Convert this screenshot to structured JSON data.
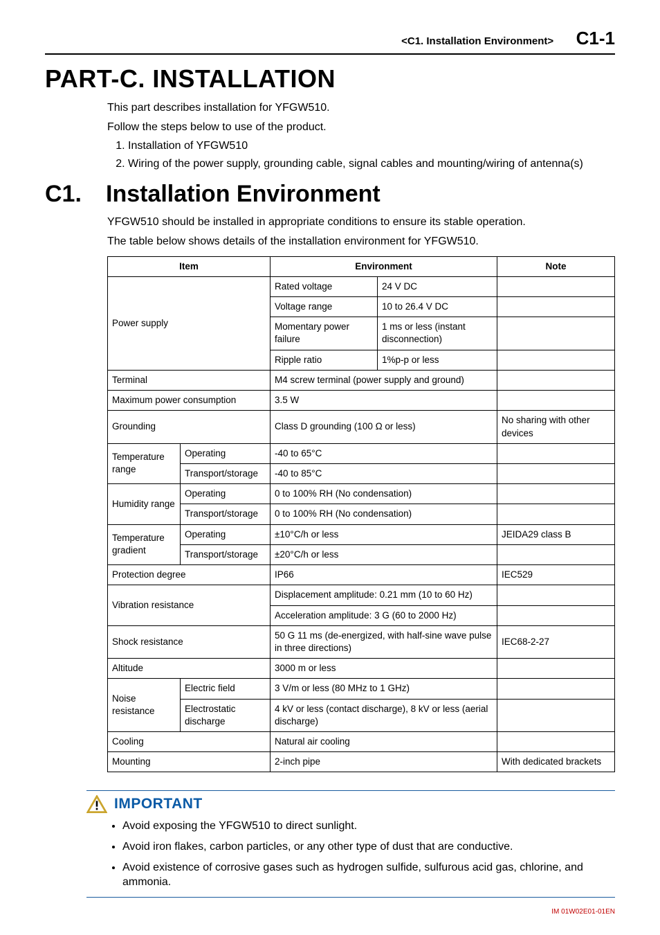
{
  "header": {
    "chapter_ref": "<C1.  Installation Environment>",
    "page_num": "C1-1"
  },
  "part": {
    "title": "PART-C.  INSTALLATION",
    "intro1": "This part describes installation for YFGW510.",
    "intro2": "Follow the steps below to use of the product.",
    "steps": [
      "Installation of YFGW510",
      "Wiring of the power supply, grounding cable, signal cables and mounting/wiring of antenna(s)"
    ]
  },
  "section": {
    "num": "C1.",
    "title": "Installation Environment",
    "p1": "YFGW510 should be installed in appropriate conditions to ensure its stable operation.",
    "p2": "The table below shows details of the installation environment for YFGW510."
  },
  "table": {
    "head": {
      "item": "Item",
      "env": "Environment",
      "note": "Note"
    },
    "rows": {
      "power_label": "Power supply",
      "power_rated_k": "Rated voltage",
      "power_rated_v": "24 V DC",
      "power_range_k": "Voltage range",
      "power_range_v": "10 to 26.4 V DC",
      "power_mom_k": "Momentary power failure",
      "power_mom_v": "1 ms or less (instant disconnection)",
      "power_ripple_k": "Ripple ratio",
      "power_ripple_v": "1%p-p or less",
      "terminal_k": "Terminal",
      "terminal_v": "M4 screw terminal (power supply and ground)",
      "maxpc_k": "Maximum power consumption",
      "maxpc_v": "3.5 W",
      "ground_k": "Grounding",
      "ground_v": "Class D grounding (100 Ω or less)",
      "ground_note": "No sharing with other devices",
      "temp_label": "Temperature range",
      "temp_op_k": "Operating",
      "temp_op_v": "-40 to 65°C",
      "temp_ts_k": "Transport/storage",
      "temp_ts_v": "-40 to 85°C",
      "hum_label": "Humidity range",
      "hum_op_k": "Operating",
      "hum_op_v": "0 to 100% RH  (No condensation)",
      "hum_ts_k": "Transport/storage",
      "hum_ts_v": "0 to 100% RH  (No condensation)",
      "tgrad_label": "Temperature gradient",
      "tgrad_op_k": "Operating",
      "tgrad_op_v": "±10°C/h or less",
      "tgrad_op_note": "JEIDA29 class B",
      "tgrad_ts_k": "Transport/storage",
      "tgrad_ts_v": "±20°C/h or less",
      "prot_k": "Protection degree",
      "prot_v": "IP66",
      "prot_note": "IEC529",
      "vib_k": "Vibration resistance",
      "vib_v1": "Displacement amplitude: 0.21 mm (10 to 60 Hz)",
      "vib_v2": "Acceleration amplitude: 3 G (60 to 2000 Hz)",
      "shock_k": "Shock resistance",
      "shock_v": "50 G 11 ms (de-energized, with half-sine wave pulse in three directions)",
      "shock_note": "IEC68-2-27",
      "alt_k": "Altitude",
      "alt_v": "3000 m or less",
      "noise_label": "Noise resistance",
      "noise_ef_k": "Electric field",
      "noise_ef_v": "3 V/m or less (80 MHz to 1 GHz)",
      "noise_esd_k": "Electrostatic discharge",
      "noise_esd_v": "4 kV or less (contact discharge), 8 kV or less (aerial discharge)",
      "cool_k": "Cooling",
      "cool_v": "Natural air cooling",
      "mount_k": "Mounting",
      "mount_v": "2-inch pipe",
      "mount_note": "With dedicated brackets"
    }
  },
  "important": {
    "label": "IMPORTANT",
    "items": [
      "Avoid exposing the YFGW510 to direct sunlight.",
      "Avoid iron flakes, carbon particles, or any other type of dust that are conductive.",
      "Avoid existence of corrosive gases such as hydrogen sulfide, sulfurous acid gas, chlorine, and ammonia."
    ]
  },
  "footer": {
    "doc_id": "IM 01W02E01-01EN"
  }
}
